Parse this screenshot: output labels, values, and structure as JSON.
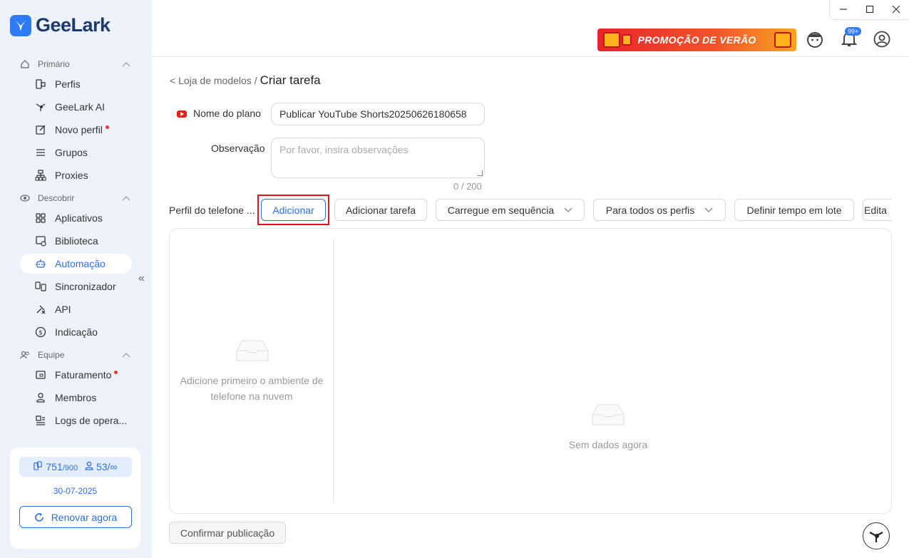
{
  "app": {
    "name": "GeeLark"
  },
  "sidebar": {
    "sections": [
      {
        "label": "Primário",
        "icon": "home-icon"
      },
      {
        "label": "Descobrir",
        "icon": "eye-icon"
      },
      {
        "label": "Equipe",
        "icon": "team-icon"
      }
    ],
    "items": [
      {
        "label": "Perfis",
        "icon": "profiles-icon"
      },
      {
        "label": "GeeLark AI",
        "icon": "ai-icon"
      },
      {
        "label": "Novo perfil",
        "icon": "edit-icon"
      },
      {
        "label": "Grupos",
        "icon": "list-icon"
      },
      {
        "label": "Proxies",
        "icon": "network-icon"
      },
      {
        "label": "Aplicativos",
        "icon": "apps-icon"
      },
      {
        "label": "Biblioteca",
        "icon": "library-icon"
      },
      {
        "label": "Automação",
        "icon": "robot-icon"
      },
      {
        "label": "Sincronizador",
        "icon": "sync-icon"
      },
      {
        "label": "API",
        "icon": "api-icon"
      },
      {
        "label": "Indicação",
        "icon": "dollar-icon"
      },
      {
        "label": "Faturamento",
        "icon": "billing-icon"
      },
      {
        "label": "Membros",
        "icon": "user-icon"
      },
      {
        "label": "Logs de opera...",
        "icon": "logs-icon"
      }
    ],
    "account": {
      "phones": "751",
      "phones_max": "/900",
      "members": "53/∞",
      "date": "30-07-2025",
      "renew_label": "Renovar agora"
    }
  },
  "topbar": {
    "promo_label": "PROMOÇÃO DE VERÃO",
    "notif_badge": "99+"
  },
  "breadcrumb": {
    "parent": "< Loja de modelos /",
    "current": "Criar tarefa"
  },
  "form": {
    "plan_label": "Nome do plano",
    "plan_value": "Publicar YouTube Shorts20250626180658",
    "obs_label": "Observação",
    "obs_placeholder": "Por favor, insira observações",
    "counter": "0 / 200"
  },
  "toolbar": {
    "label": "Perfil do telefone ...",
    "add": "Adicionar",
    "add_task": "Adicionar tarefa",
    "load_seq": "Carregue em sequência",
    "all_profiles": "Para todos os perfis",
    "batch_time": "Definir tempo em lote",
    "edit": "Edita"
  },
  "panel": {
    "left_empty": "Adicione primeiro o ambiente de telefone na nuvem",
    "right_empty": "Sem dados agora"
  },
  "footer": {
    "confirm": "Confirmar publicação"
  }
}
